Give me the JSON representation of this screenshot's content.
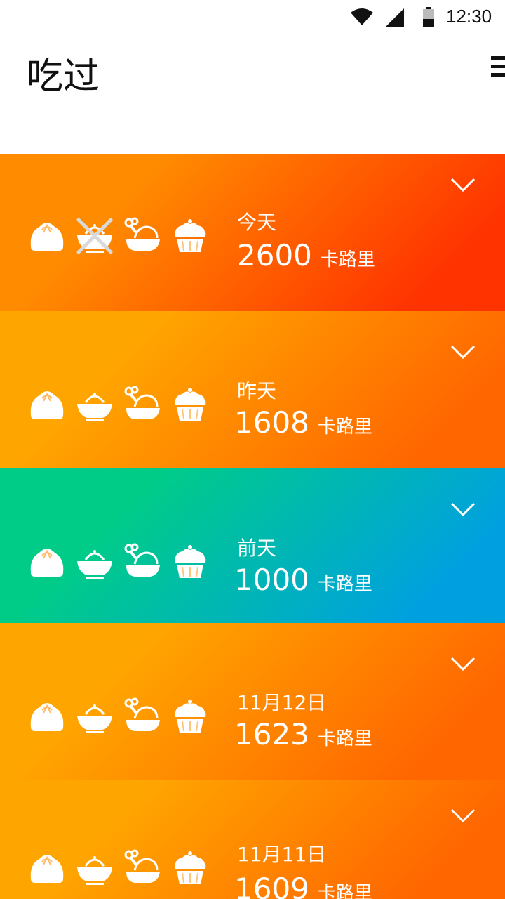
{
  "status_bar": {
    "time": "12:30"
  },
  "app_bar": {
    "title": "吃过"
  },
  "days": [
    {
      "label": "今天",
      "calories": "2600",
      "unit": "卡路里",
      "rice_skipped": true,
      "gradient_from": "#FF8C00",
      "gradient_to": "#FF3300"
    },
    {
      "label": "昨天",
      "calories": "1608",
      "unit": "卡路里",
      "rice_skipped": false,
      "gradient_from": "#FFA500",
      "gradient_to": "#FF6600"
    },
    {
      "label": "前天",
      "calories": "1000",
      "unit": "卡路里",
      "rice_skipped": false,
      "gradient_from": "#00CC88",
      "gradient_to": "#00A0E0"
    },
    {
      "label": "11月12日",
      "calories": "1623",
      "unit": "卡路里",
      "rice_skipped": false,
      "gradient_from": "#FFA500",
      "gradient_to": "#FF6600"
    },
    {
      "label": "11月11日",
      "calories": "1609",
      "unit": "卡路里",
      "rice_skipped": false,
      "gradient_from": "#FFA500",
      "gradient_to": "#FF6600"
    }
  ],
  "meal_icons": [
    "bun-icon",
    "rice-bowl-icon",
    "chicken-icon",
    "cupcake-icon"
  ]
}
